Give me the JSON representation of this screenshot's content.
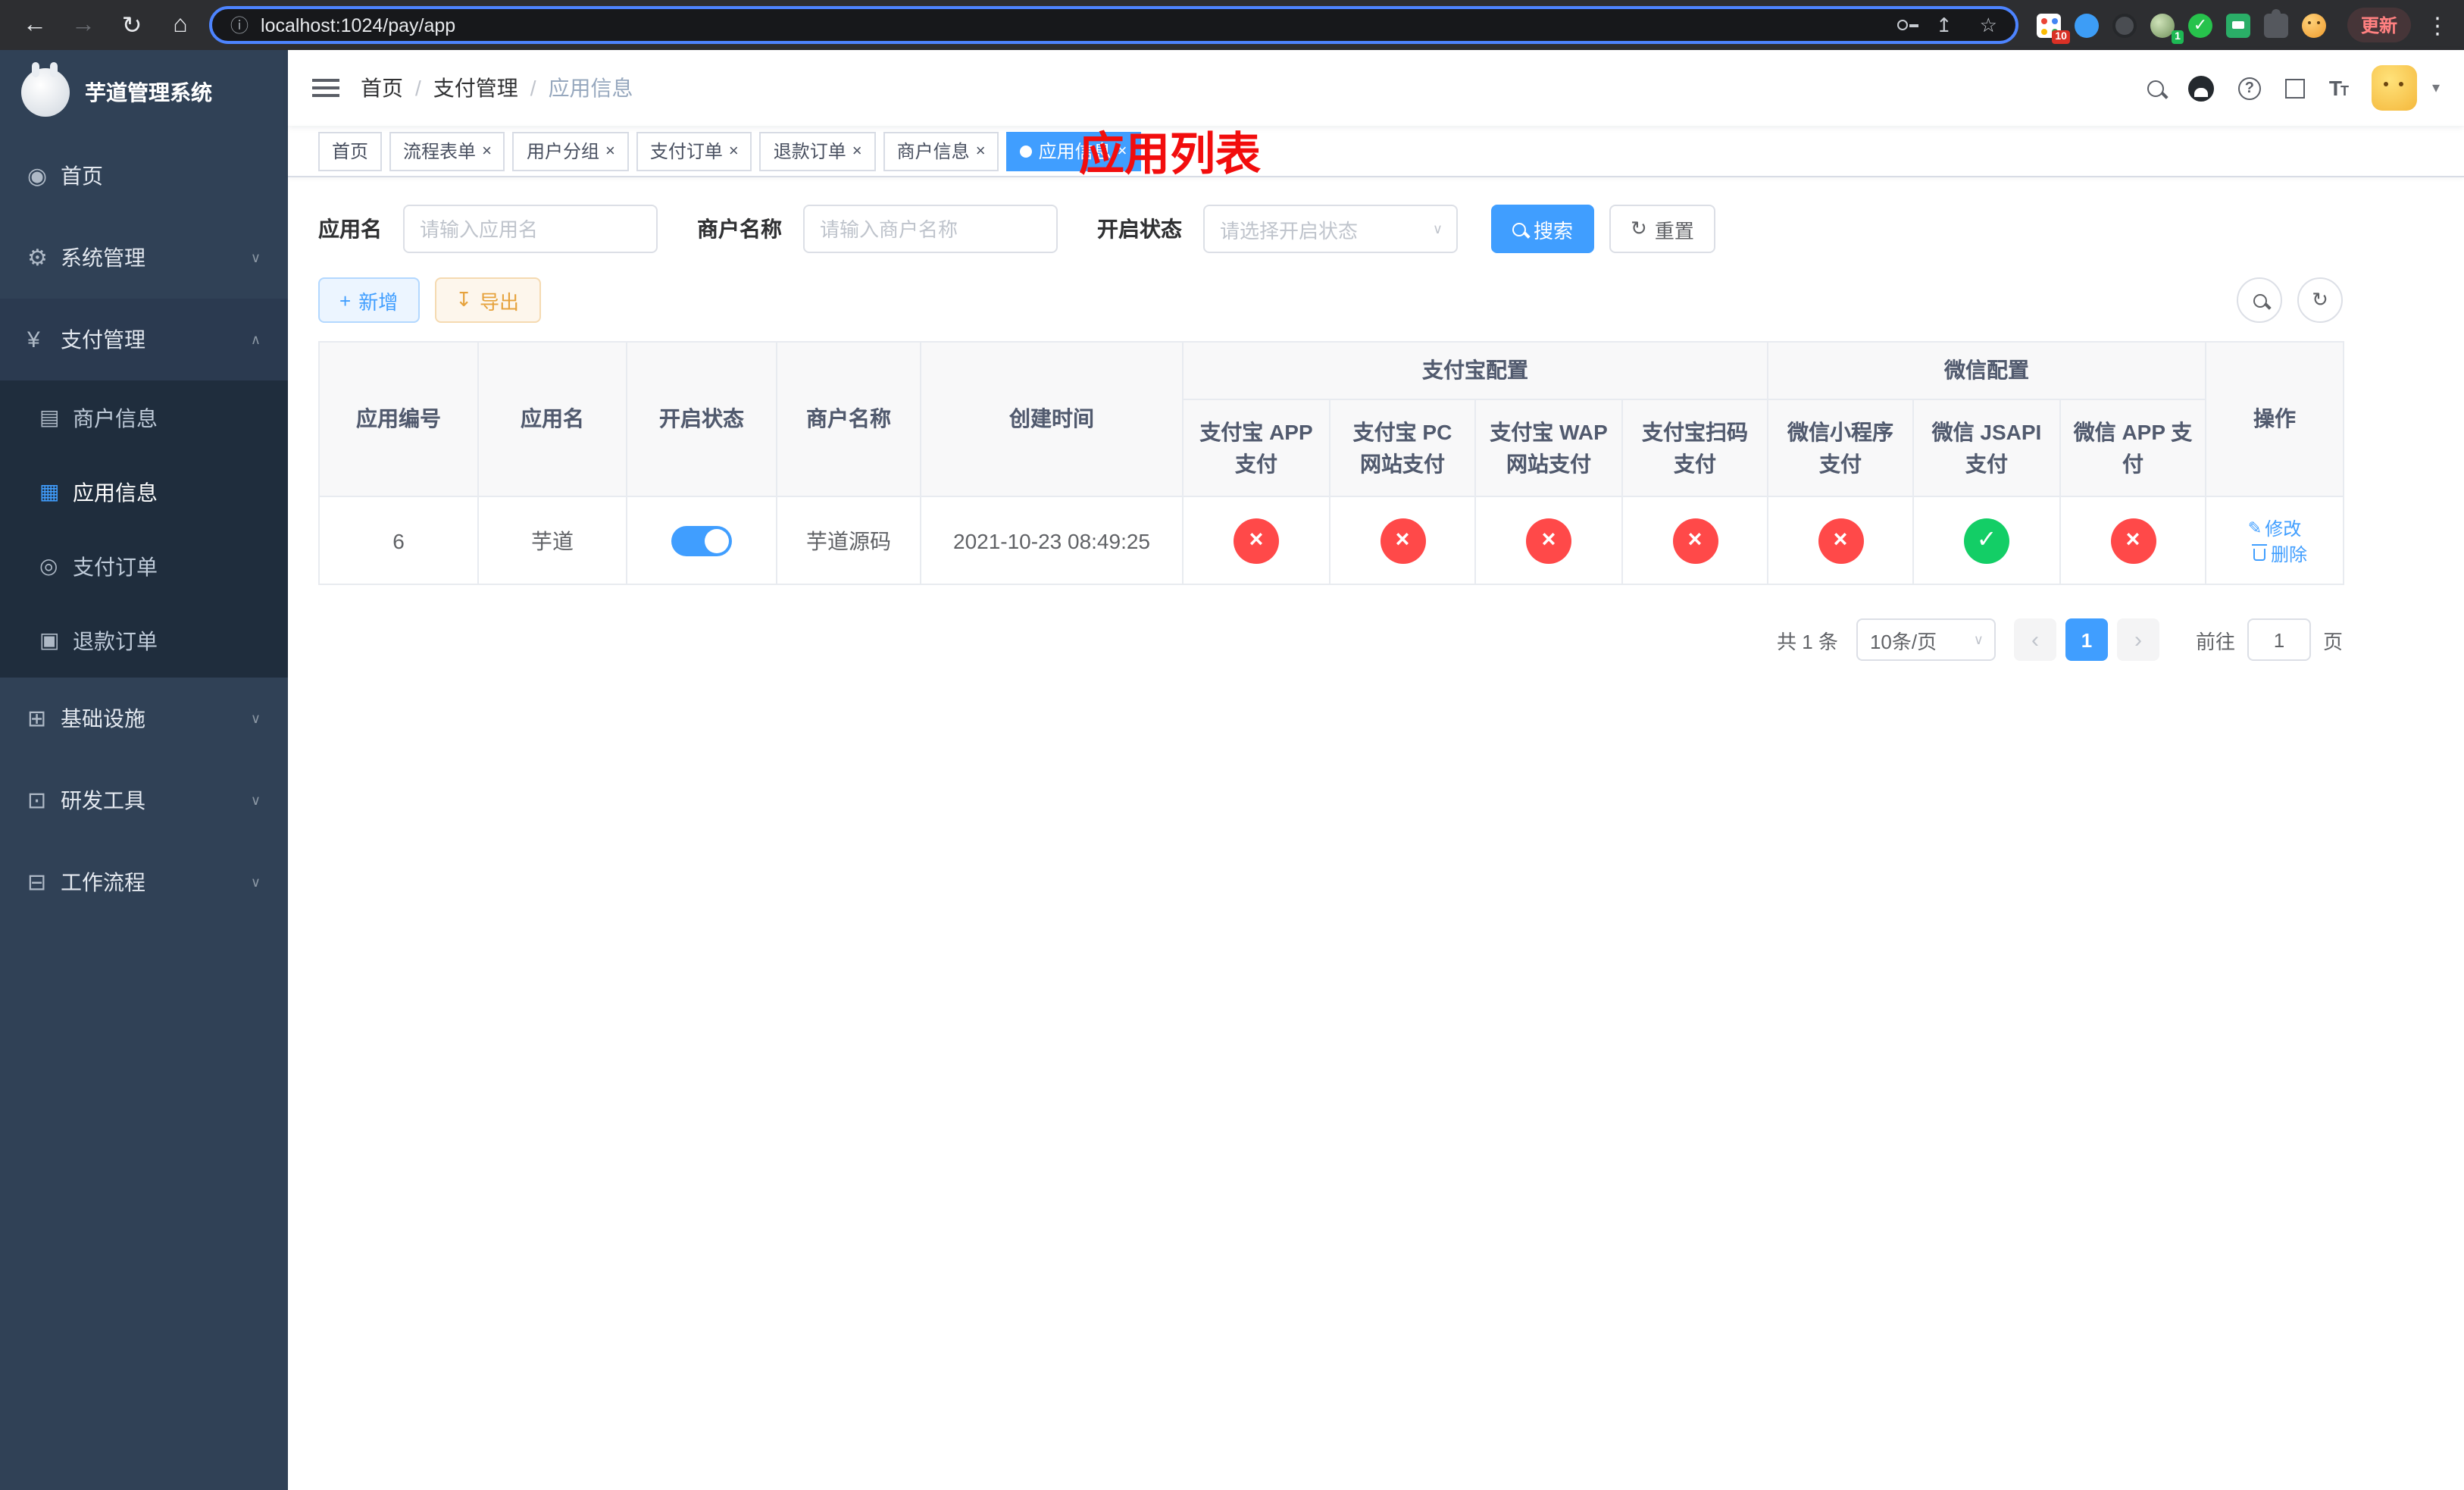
{
  "browser": {
    "url": "localhost:1024/pay/app",
    "update_label": "更新",
    "ext_badge_1": "10",
    "ext_badge_2": "1"
  },
  "sidebar": {
    "title": "芋道管理系统",
    "items": [
      {
        "label": "首页"
      },
      {
        "label": "系统管理"
      },
      {
        "label": "支付管理",
        "children": [
          {
            "label": "商户信息"
          },
          {
            "label": "应用信息",
            "active": true
          },
          {
            "label": "支付订单"
          },
          {
            "label": "退款订单"
          }
        ]
      },
      {
        "label": "基础设施"
      },
      {
        "label": "研发工具"
      },
      {
        "label": "工作流程"
      }
    ]
  },
  "navbar": {
    "breadcrumb": [
      "首页",
      "支付管理",
      "应用信息"
    ],
    "page_title": "应用列表"
  },
  "tabs": [
    {
      "label": "首页"
    },
    {
      "label": "流程表单"
    },
    {
      "label": "用户分组"
    },
    {
      "label": "支付订单"
    },
    {
      "label": "退款订单"
    },
    {
      "label": "商户信息"
    },
    {
      "label": "应用信息"
    }
  ],
  "filters": {
    "app_name_label": "应用名",
    "app_name_placeholder": "请输入应用名",
    "merchant_label": "商户名称",
    "merchant_placeholder": "请输入商户名称",
    "status_label": "开启状态",
    "status_placeholder": "请选择开启状态",
    "search_label": "搜索",
    "reset_label": "重置"
  },
  "toolbar": {
    "add_label": "新增",
    "export_label": "导出"
  },
  "table": {
    "groups": [
      {
        "label": "支付宝配置"
      },
      {
        "label": "微信配置"
      }
    ],
    "columns": [
      "应用编号",
      "应用名",
      "开启状态",
      "商户名称",
      "创建时间",
      "支付宝 APP 支付",
      "支付宝 PC 网站支付",
      "支付宝 WAP 网站支付",
      "支付宝扫码支付",
      "微信小程序支付",
      "微信 JSAPI 支付",
      "微信 APP 支付",
      "操作"
    ],
    "rows": [
      {
        "id": "6",
        "app_name": "芋道",
        "status_on": true,
        "merchant": "芋道源码",
        "created_at": "2021-10-23 08:49:25",
        "alipay_app": false,
        "alipay_pc": false,
        "alipay_wap": false,
        "alipay_qr": false,
        "wx_lite": false,
        "wx_jsapi": true,
        "wx_app": false,
        "edit_label": "修改",
        "delete_label": "删除"
      }
    ]
  },
  "pagination": {
    "total_label": "共 1 条",
    "page_size_label": "10条/页",
    "current_page": "1",
    "goto_label": "前往",
    "goto_value": "1",
    "page_suffix": "页"
  },
  "colors": {
    "primary": "#409eff",
    "success": "#13ce66",
    "danger": "#ff4949",
    "sidebar_bg": "#304156",
    "submenu_bg": "#1f2d3d",
    "title_red": "#f20d0d"
  }
}
